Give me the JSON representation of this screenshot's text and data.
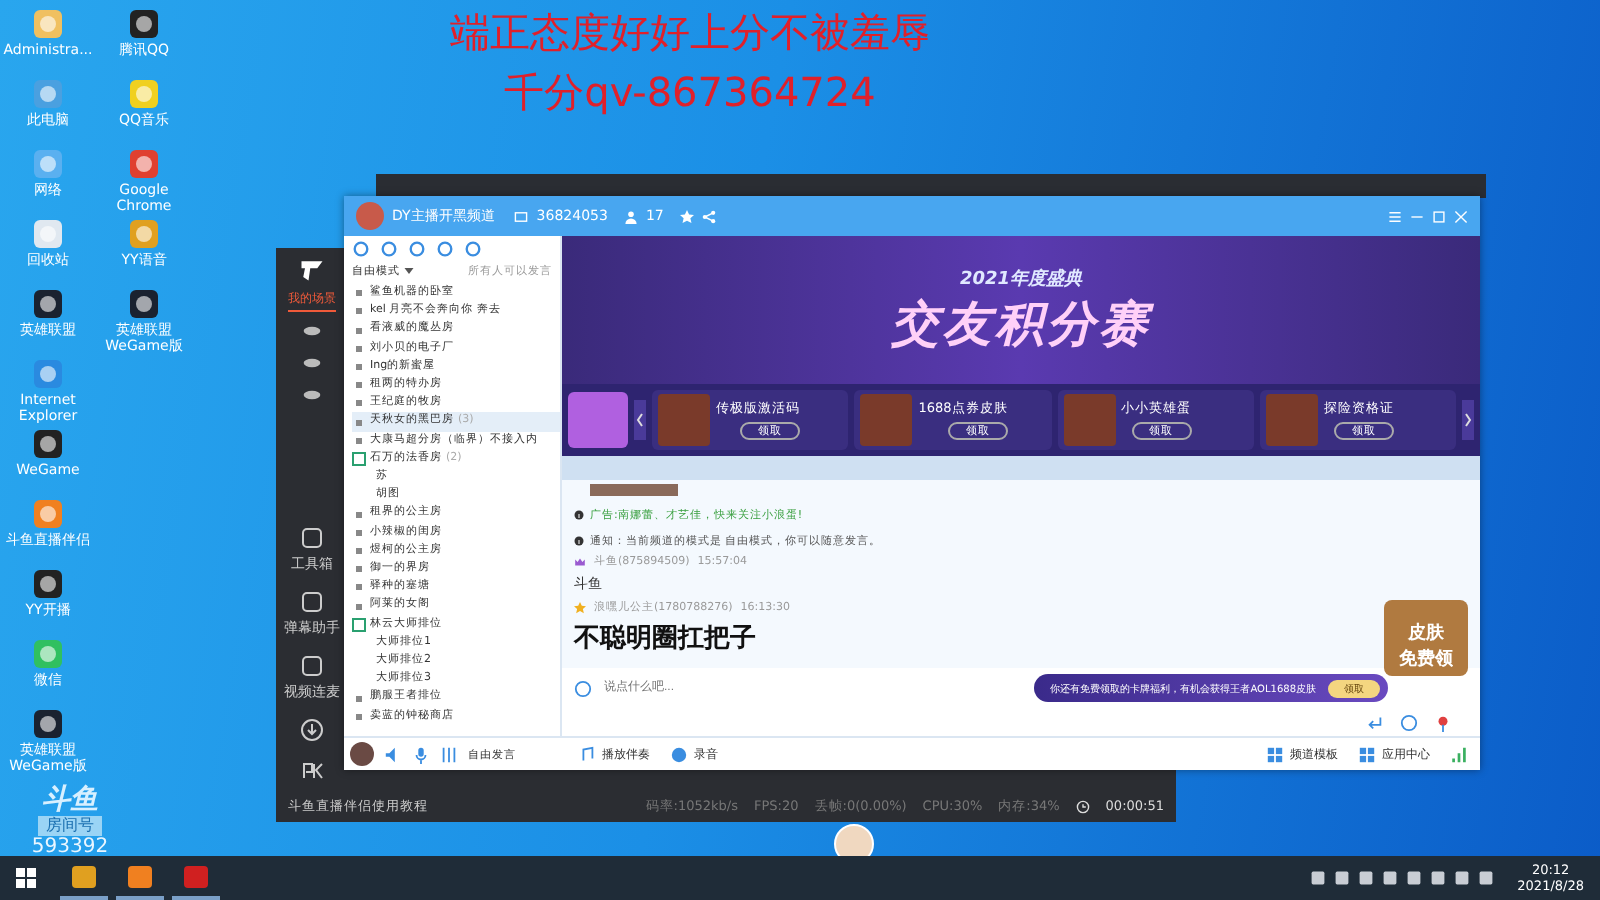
{
  "overlay_text": [
    "端正态度好好上分不被羞辱",
    "千分qv-867364724"
  ],
  "desktop_icons": [
    {
      "label": "Administra..."
    },
    {
      "label": "此电脑"
    },
    {
      "label": "网络"
    },
    {
      "label": "回收站"
    },
    {
      "label": "英雄联盟"
    },
    {
      "label": "Internet Explorer"
    },
    {
      "label": "WeGame"
    },
    {
      "label": "斗鱼直播伴侣"
    },
    {
      "label": "YY开播"
    },
    {
      "label": "微信"
    },
    {
      "label": "英雄联盟 WeGame版"
    },
    {
      "label": "腾讯QQ"
    },
    {
      "label": "QQ音乐"
    },
    {
      "label": "Google Chrome"
    },
    {
      "label": "YY语音"
    },
    {
      "label": "英雄联盟 WeGame版"
    }
  ],
  "room_badge": {
    "brand": "斗鱼",
    "label": "房间号",
    "number": "593392"
  },
  "streamer_window": {
    "tabs": [
      {
        "label": "我的场景",
        "selected": true
      }
    ],
    "tools": [
      "工具箱",
      "弹幕助手",
      "视频连麦"
    ],
    "tutorial_link": "斗鱼直播伴侣使用教程",
    "stats": [
      "码率:1052kb/s",
      "FPS:20",
      "丢帧:0(0.00%)",
      "CPU:30%",
      "内存:34%"
    ],
    "timer": "00:00:51"
  },
  "yy_window": {
    "title": "DY主播开黑频道",
    "room_id": "36824053",
    "online": "17",
    "mode": "自由模式",
    "mode_hint": "所有人可以发言",
    "channels": [
      {
        "name": "鲨鱼机器的卧室",
        "selected": false
      },
      {
        "name": "kel 月亮不会奔向你 奔去",
        "selected": false
      },
      {
        "name": "看液威的魔丛房",
        "selected": false
      },
      {
        "name": "刘小贝的电子厂",
        "selected": false
      },
      {
        "name": "Ing的新蜜屋",
        "selected": false
      },
      {
        "name": "租两的特办房",
        "selected": false
      },
      {
        "name": "王纪庭的牧房",
        "selected": false
      },
      {
        "name": "天秋女的黑巴房",
        "count": "(3)",
        "selected": true
      },
      {
        "name": "大康马超分房（临界）不接入内",
        "selected": false
      },
      {
        "name": "石万的法香房",
        "count": "(2)",
        "selected": false,
        "expanded": true,
        "children": [
          {
            "name": "苏"
          },
          {
            "name": "胡图"
          }
        ]
      },
      {
        "name": "租界的公主房",
        "selected": false
      },
      {
        "name": "小辣椒的闺房",
        "selected": false
      },
      {
        "name": "煜柯的公主房",
        "selected": false
      },
      {
        "name": "御一的界房",
        "selected": false
      },
      {
        "name": "驿种的塞塘",
        "selected": false
      },
      {
        "name": "阿莱的女阁",
        "selected": false
      },
      {
        "name": "林云大师排位",
        "selected": false,
        "expanded": true,
        "children": [
          {
            "name": "大师排位1"
          },
          {
            "name": "大师排位2"
          },
          {
            "name": "大师排位3"
          }
        ]
      },
      {
        "name": "鹏服王者排位",
        "selected": false
      },
      {
        "name": "卖蓝的钟秘商店",
        "selected": false
      }
    ],
    "mic_label": "自由发言",
    "banner": {
      "subtitle": "2021年度盛典",
      "title": "交友积分赛"
    },
    "promos": [
      {
        "title": "传极版激活码",
        "button": "领取"
      },
      {
        "title": "1688点券皮肤",
        "button": "领取"
      },
      {
        "title": "小小英雄蛋",
        "button": "领取"
      },
      {
        "title": "探险资格证",
        "button": "领取"
      }
    ],
    "messages": [
      {
        "kind": "notice",
        "text": "广告:南娜蕾、才艺佳，快来关注小浪蛋!"
      },
      {
        "kind": "notice",
        "text": "通知：当前频道的模式是 自由模式，你可以随意发言。"
      },
      {
        "kind": "chat",
        "sender": "斗鱼(875894509)",
        "time": "15:57:04",
        "text": "斗鱼"
      },
      {
        "kind": "shout",
        "sender": "浪嘿儿公主(1780788276)",
        "time": "16:13:30",
        "text": "不聪明圈扛把子"
      }
    ],
    "input": {
      "placeholder": "说点什么吧..."
    },
    "ad": {
      "text": "你还有免费领取的卡牌福利，有机会获得王者AOL1688皮肤",
      "button": "领取"
    },
    "skin_ad": [
      "皮肤",
      "免费领"
    ],
    "toolbar_left": [
      "播放伴奏",
      "录音"
    ],
    "toolbar_right": [
      "频道模板",
      "应用中心"
    ]
  },
  "taskbar": {
    "time": "20:12",
    "date": "2021/8/28"
  }
}
